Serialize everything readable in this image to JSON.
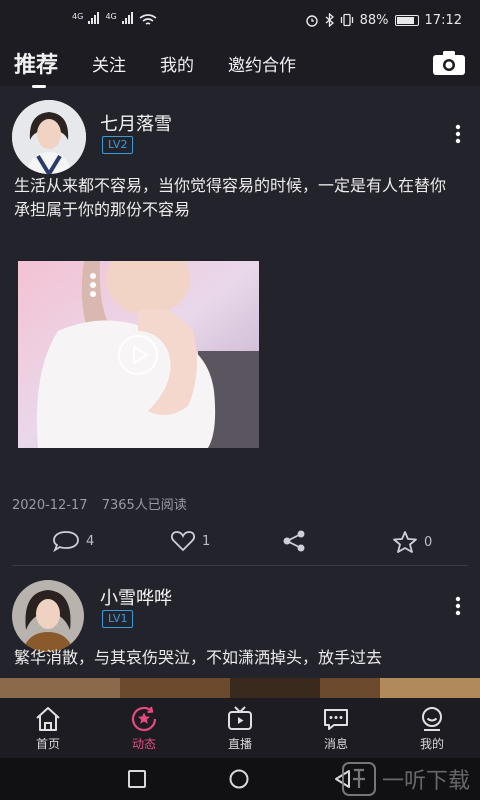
{
  "status_bar": {
    "signal_1_label": "4G",
    "signal_2_label": "4G",
    "battery_percent": "88%",
    "battery_level": 0.88,
    "time": "17:12",
    "icons": [
      "wifi-icon",
      "alarm-icon",
      "bluetooth-icon",
      "vibrate-icon",
      "battery-icon"
    ]
  },
  "top_nav": {
    "tabs": [
      {
        "label": "推荐",
        "active": true
      },
      {
        "label": "关注",
        "active": false
      },
      {
        "label": "我的",
        "active": false
      },
      {
        "label": "邀约合作",
        "active": false
      }
    ],
    "camera_icon": "camera-icon"
  },
  "posts": [
    {
      "username": "七月落雪",
      "level": "LV2",
      "text": "生活从来都不容易，当你觉得容易的时候，一定是有人在替你承担属于你的那份不容易",
      "media": "video",
      "date": "2020-12-17",
      "reads": "7365人已阅读",
      "comments": "4",
      "likes": "1",
      "stars": "0"
    },
    {
      "username": "小雪哗哗",
      "level": "LV1",
      "text": "繁华消散，与其哀伤哭泣，不如潇洒掉头，放手过去"
    }
  ],
  "bottom_nav": [
    {
      "label": "首页",
      "icon": "home-icon",
      "active": false
    },
    {
      "label": "动态",
      "icon": "dynamic-icon",
      "active": true
    },
    {
      "label": "直播",
      "icon": "live-tv-icon",
      "active": false
    },
    {
      "label": "消息",
      "icon": "message-icon",
      "active": false
    },
    {
      "label": "我的",
      "icon": "profile-icon",
      "active": false
    }
  ],
  "watermark": {
    "text": "一听下载"
  },
  "colors": {
    "background": "#23232b",
    "bar": "#1c1c22",
    "accent_pink": "#e84a7f",
    "level_blue": "#3a9ad9"
  }
}
